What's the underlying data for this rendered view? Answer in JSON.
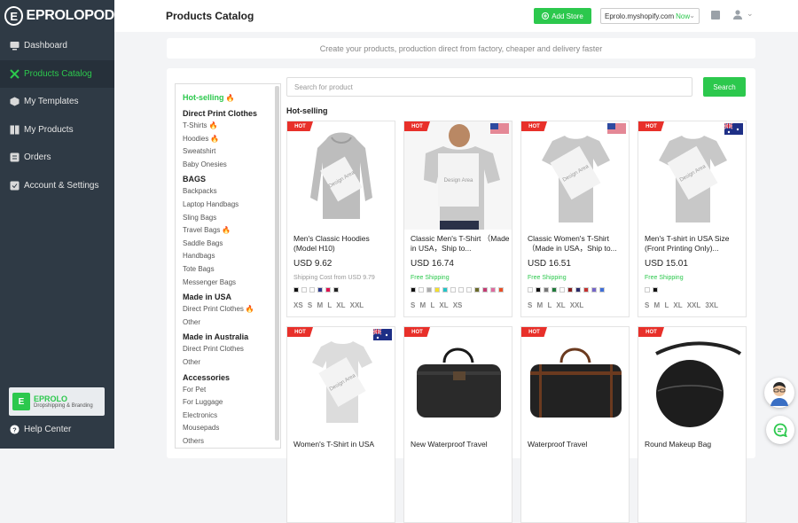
{
  "brand": {
    "logo_text": "EPROLO",
    "logo_suffix": "POD"
  },
  "sidebar": {
    "items": [
      {
        "label": "Dashboard",
        "icon": "monitor-icon"
      },
      {
        "label": "Products Catalog",
        "icon": "tools-icon",
        "active": true
      },
      {
        "label": "My Templates",
        "icon": "box-icon"
      },
      {
        "label": "My Products",
        "icon": "book-icon"
      },
      {
        "label": "Orders",
        "icon": "list-icon"
      },
      {
        "label": "Account & Settings",
        "icon": "settings-icon"
      }
    ],
    "promo": {
      "title": "EPROLO",
      "subtitle": "Dropshipping & Branding"
    },
    "help": "Help Center"
  },
  "header": {
    "title": "Products Catalog",
    "add_store": "Add Store",
    "store_name": "Eprolo.myshopify.com",
    "store_status": "Now"
  },
  "banner": "Create your products, production direct from factory, cheaper and delivery faster",
  "search": {
    "placeholder": "Search for product",
    "button": "Search"
  },
  "categories": [
    {
      "heading": "Hot-selling",
      "green": true,
      "fire": true,
      "items": []
    },
    {
      "heading": "Direct Print Clothes",
      "items": [
        {
          "label": "T-Shirts",
          "fire": true
        },
        {
          "label": "Hoodies",
          "fire": true
        },
        {
          "label": "Sweatshirt"
        },
        {
          "label": "Baby Onesies"
        }
      ]
    },
    {
      "heading": "BAGS",
      "items": [
        {
          "label": "Backpacks"
        },
        {
          "label": "Laptop Handbags"
        },
        {
          "label": "Sling Bags"
        },
        {
          "label": "Travel Bags",
          "fire": true
        },
        {
          "label": "Saddle Bags"
        },
        {
          "label": "Handbags"
        },
        {
          "label": "Tote Bags"
        },
        {
          "label": "Messenger Bags"
        }
      ]
    },
    {
      "heading": "Made in USA",
      "items": [
        {
          "label": "Direct Print Clothes",
          "fire": true
        },
        {
          "label": "Other"
        }
      ]
    },
    {
      "heading": "Made in Australia",
      "items": [
        {
          "label": "Direct Print Clothes"
        },
        {
          "label": "Other"
        }
      ]
    },
    {
      "heading": "Accessories",
      "items": [
        {
          "label": "For Pet"
        },
        {
          "label": "For Luggage"
        },
        {
          "label": "Electronics"
        },
        {
          "label": "Mousepads"
        },
        {
          "label": "Others"
        }
      ]
    }
  ],
  "section_title": "Hot-selling",
  "hot_label": "HOT",
  "design_area": "Design Area",
  "products": [
    {
      "name": "Men's Classic Hoodies (Model H10)",
      "price": "USD 9.62",
      "shipping": "Shipping Cost from USD 9.79",
      "ship_gray": true,
      "flag": "",
      "kind": "hoodie",
      "colors": [
        "#111111",
        "#ffffff",
        "#ffffff",
        "#2b3a8c",
        "#e0124f",
        "#222222"
      ],
      "sizes": "XS S M L XL XXL"
    },
    {
      "name": "Classic Men's T-Shirt （Made in USA，Ship to...",
      "price": "USD 16.74",
      "shipping": "Free Shipping",
      "flag": "us",
      "kind": "model",
      "colors": [
        "#111111",
        "#ffffff",
        "#aaaaaa",
        "#f5e02a",
        "#22c5c8",
        "#ffffff",
        "#ffffff",
        "#ffffff",
        "#6b6b2a",
        "#c23b72",
        "#e06aa0",
        "#e85028"
      ],
      "sizes": "S M L XL XS"
    },
    {
      "name": "Classic Women's T-Shirt （Made in USA，Ship to...",
      "price": "USD 16.51",
      "shipping": "Free Shipping",
      "flag": "us",
      "kind": "tee",
      "colors": [
        "#ffffff",
        "#111111",
        "#777777",
        "#1f7a3a",
        "#ffffff",
        "#8a1f1f",
        "#2a2a6a",
        "#c4312f",
        "#7565c8",
        "#3f6fd8"
      ],
      "sizes": "S M L XL XXL"
    },
    {
      "name": "Men's T-shirt in USA Size (Front Printing Only)...",
      "price": "USD 15.01",
      "shipping": "Free Shipping",
      "flag": "au",
      "kind": "tee",
      "colors": [
        "#ffffff",
        "#111111"
      ],
      "sizes": "S M L XL XXL 3XL"
    },
    {
      "name": "Women's T-Shirt in USA",
      "flag": "au",
      "kind": "womentee"
    },
    {
      "name": "New Waterproof Travel",
      "flag": "",
      "kind": "duffel"
    },
    {
      "name": "Waterproof Travel",
      "flag": "",
      "kind": "duffel2"
    },
    {
      "name": "Round Makeup Bag",
      "flag": "",
      "kind": "round"
    }
  ]
}
